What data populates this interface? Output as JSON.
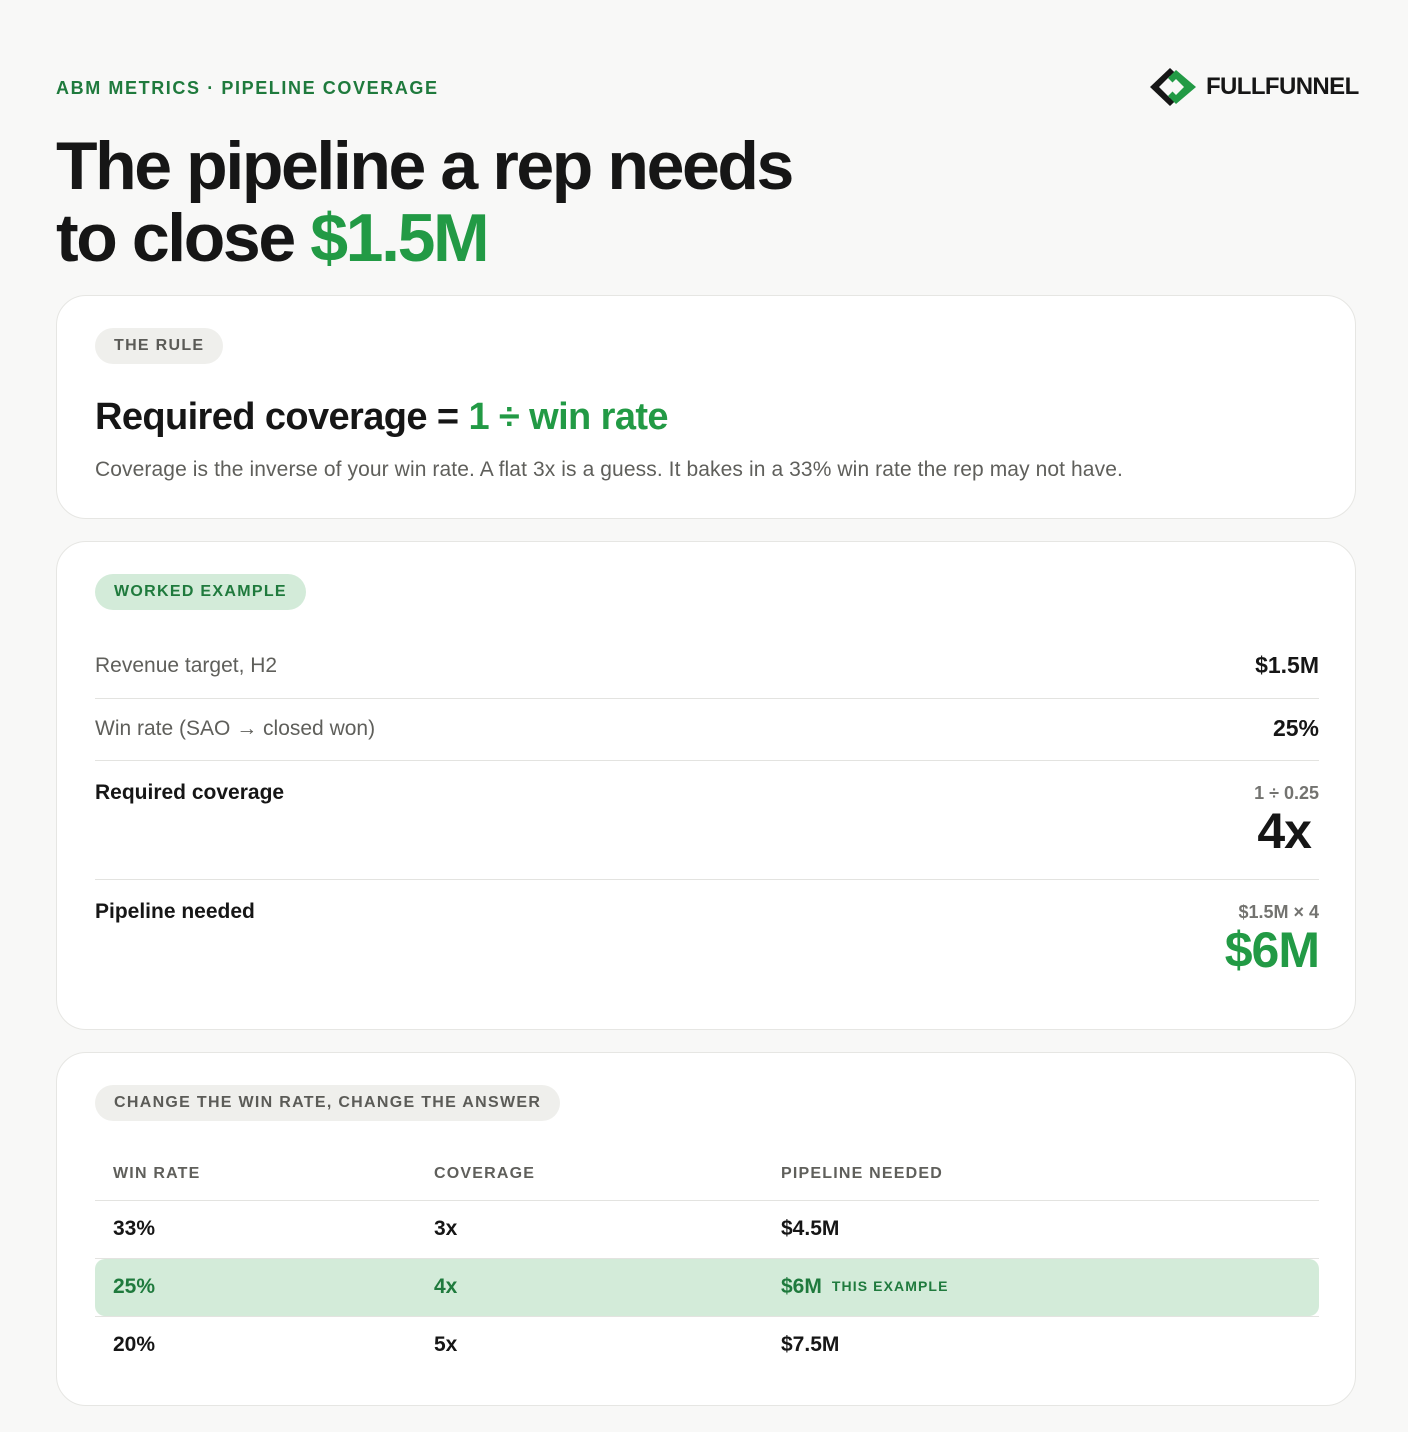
{
  "header": {
    "eyebrow": "ABM METRICS · PIPELINE COVERAGE",
    "logo_text": "FULLFUNNEL",
    "title_line1": "The pipeline a rep needs",
    "title_line2_prefix": "to close ",
    "title_line2_accent": "$1.5M"
  },
  "rule": {
    "pill": "THE RULE",
    "title_prefix": "Required coverage = ",
    "title_accent": "1 ÷ win rate",
    "description": "Coverage is the inverse of your win rate. A flat 3x is a guess. It bakes in a 33% win rate the rep may not have."
  },
  "example": {
    "pill": "WORKED EXAMPLE",
    "rows": [
      {
        "label": "Revenue target, H2",
        "value": "$1.5M"
      },
      {
        "label": "Win rate (SAO → closed won)",
        "value": "25%"
      },
      {
        "label": "Required coverage",
        "calc": "1 ÷ 0.25",
        "value": "4x"
      },
      {
        "label": "Pipeline needed",
        "calc": "$1.5M × 4",
        "value": "$6M"
      }
    ]
  },
  "table": {
    "pill": "CHANGE THE WIN RATE, CHANGE THE ANSWER",
    "headers": [
      "WIN RATE",
      "COVERAGE",
      "PIPELINE NEEDED"
    ],
    "rows": [
      {
        "win_rate": "33%",
        "coverage": "3x",
        "pipeline": "$4.5M",
        "tag": ""
      },
      {
        "win_rate": "25%",
        "coverage": "4x",
        "pipeline": "$6M",
        "tag": "THIS EXAMPLE"
      },
      {
        "win_rate": "20%",
        "coverage": "5x",
        "pipeline": "$7.5M",
        "tag": ""
      }
    ]
  },
  "colors": {
    "accent": "#229a45",
    "accent_dark": "#1f7a3d",
    "highlight": "#d3ebd9",
    "text": "#161616",
    "muted": "#5f5f5b"
  }
}
